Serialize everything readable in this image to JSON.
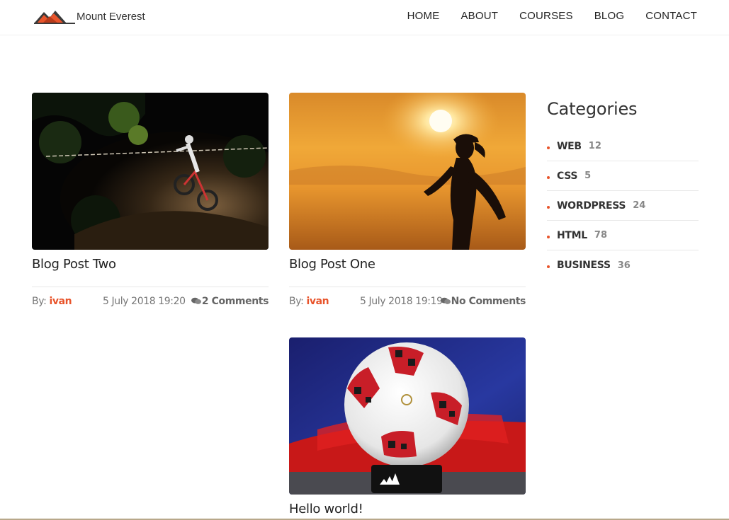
{
  "site": {
    "logo_text": "Mount Everest"
  },
  "nav": [
    {
      "label": "HOME"
    },
    {
      "label": "ABOUT"
    },
    {
      "label": "COURSES"
    },
    {
      "label": "BLOG"
    },
    {
      "label": "CONTACT"
    }
  ],
  "posts": [
    {
      "title": "Blog Post Two",
      "by_label": "By:",
      "author": "ivan",
      "date": "5 July 2018 19:20",
      "comments": "2 Comments"
    },
    {
      "title": "Blog Post One",
      "by_label": "By:",
      "author": "ivan",
      "date": "5 July 2018 19:19",
      "comments": "No Comments"
    },
    {
      "title": "Hello world!"
    }
  ],
  "sidebar": {
    "heading": "Categories",
    "categories": [
      {
        "name": "WEB",
        "count": "12"
      },
      {
        "name": "CSS",
        "count": "5"
      },
      {
        "name": "WORDPRESS",
        "count": "24"
      },
      {
        "name": "HTML",
        "count": "78"
      },
      {
        "name": "BUSINESS",
        "count": "36"
      }
    ]
  },
  "colors": {
    "accent": "#e8542b",
    "text": "#333333",
    "muted": "#777777"
  }
}
